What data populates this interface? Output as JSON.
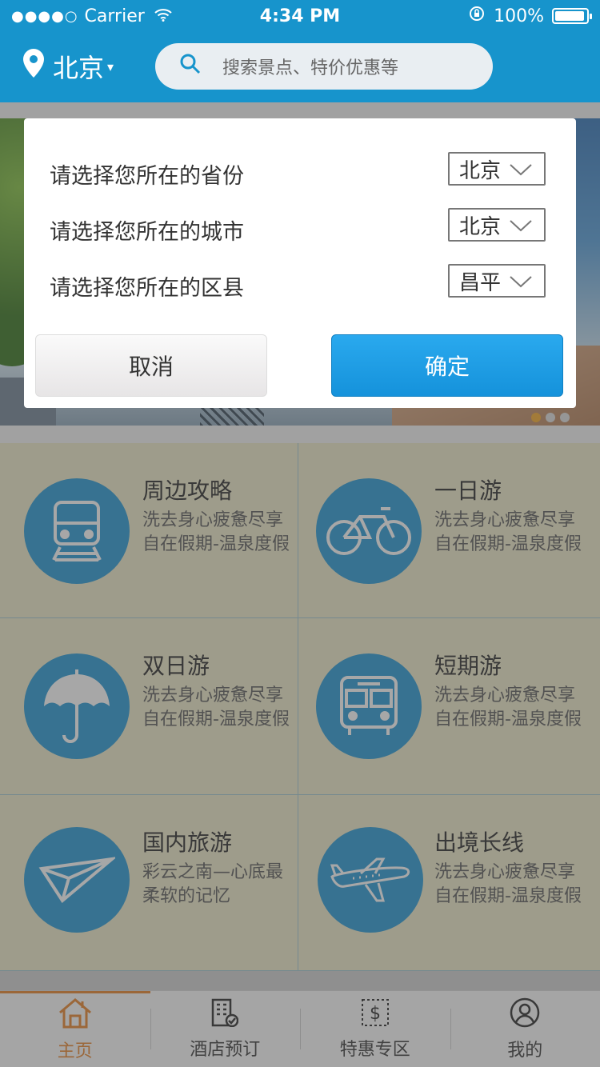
{
  "status_bar": {
    "signal": "●●●●○",
    "carrier": "Carrier",
    "time": "4:34 PM",
    "battery": "100%"
  },
  "header": {
    "city": "北京",
    "search_placeholder": "搜索景点、特价优惠等"
  },
  "dialog": {
    "rows": [
      {
        "label": "请选择您所在的省份",
        "value": "北京"
      },
      {
        "label": "请选择您所在的城市",
        "value": "北京"
      },
      {
        "label": "请选择您所在的区县",
        "value": "昌平"
      }
    ],
    "cancel": "取消",
    "confirm": "确定"
  },
  "categories": [
    {
      "title": "周边攻略",
      "desc": "洗去身心疲惫尽享自在假期-温泉度假",
      "icon": "train-icon"
    },
    {
      "title": "一日游",
      "desc": "洗去身心疲惫尽享自在假期-温泉度假",
      "icon": "bicycle-icon"
    },
    {
      "title": "双日游",
      "desc": "洗去身心疲惫尽享自在假期-温泉度假",
      "icon": "umbrella-icon"
    },
    {
      "title": "短期游",
      "desc": "洗去身心疲惫尽享自在假期-温泉度假",
      "icon": "bus-icon"
    },
    {
      "title": "国内旅游",
      "desc": "彩云之南—心底最柔软的记忆",
      "icon": "paper-plane-icon"
    },
    {
      "title": "出境长线",
      "desc": "洗去身心疲惫尽享自在假期-温泉度假",
      "icon": "airplane-icon"
    }
  ],
  "tabs": [
    {
      "label": "主页",
      "icon": "home-icon",
      "active": true
    },
    {
      "label": "酒店预订",
      "icon": "hotel-icon",
      "active": false
    },
    {
      "label": "特惠专区",
      "icon": "coupon-icon",
      "active": false
    },
    {
      "label": "我的",
      "icon": "user-icon",
      "active": false
    }
  ],
  "colors": {
    "primary": "#1794cc",
    "accent": "#e67e22",
    "confirm": "#1592db"
  }
}
